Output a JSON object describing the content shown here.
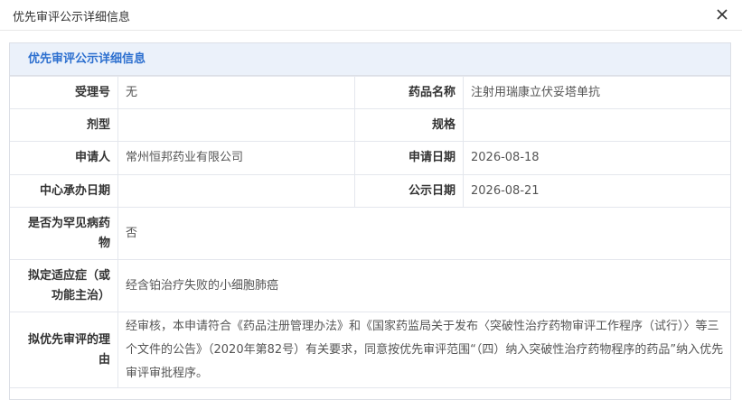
{
  "dialog": {
    "title": "优先审评公示详细信息",
    "close_icon": "close-icon"
  },
  "panel": {
    "header": "优先审评公示详细信息"
  },
  "fields": {
    "accept_no_label": "受理号",
    "accept_no": "无",
    "drug_name_label": "药品名称",
    "drug_name": "注射用瑞康立伏妥塔单抗",
    "dosage_form_label": "剂型",
    "dosage_form": "",
    "spec_label": "规格",
    "spec": "",
    "applicant_label": "申请人",
    "applicant": "常州恒邦药业有限公司",
    "apply_date_label": "申请日期",
    "apply_date": "2026-08-18",
    "center_date_label": "中心承办日期",
    "center_date": "",
    "publish_date_label": "公示日期",
    "publish_date": "2026-08-21",
    "rare_disease_label": "是否为罕见病药物",
    "rare_disease": "否",
    "indication_label": "拟定适应症（或功能主治）",
    "indication": "经含铂治疗失败的小细胞肺癌",
    "reason_label": "拟优先审评的理由",
    "reason": "经审核，本申请符合《药品注册管理办法》和《国家药监局关于发布〈突破性治疗药物审评工作程序（试行）〉等三个文件的公告》（2020年第82号）有关要求，同意按优先审评范围“（四）纳入突破性治疗药物程序的药品”纳入优先审评审批程序。"
  }
}
